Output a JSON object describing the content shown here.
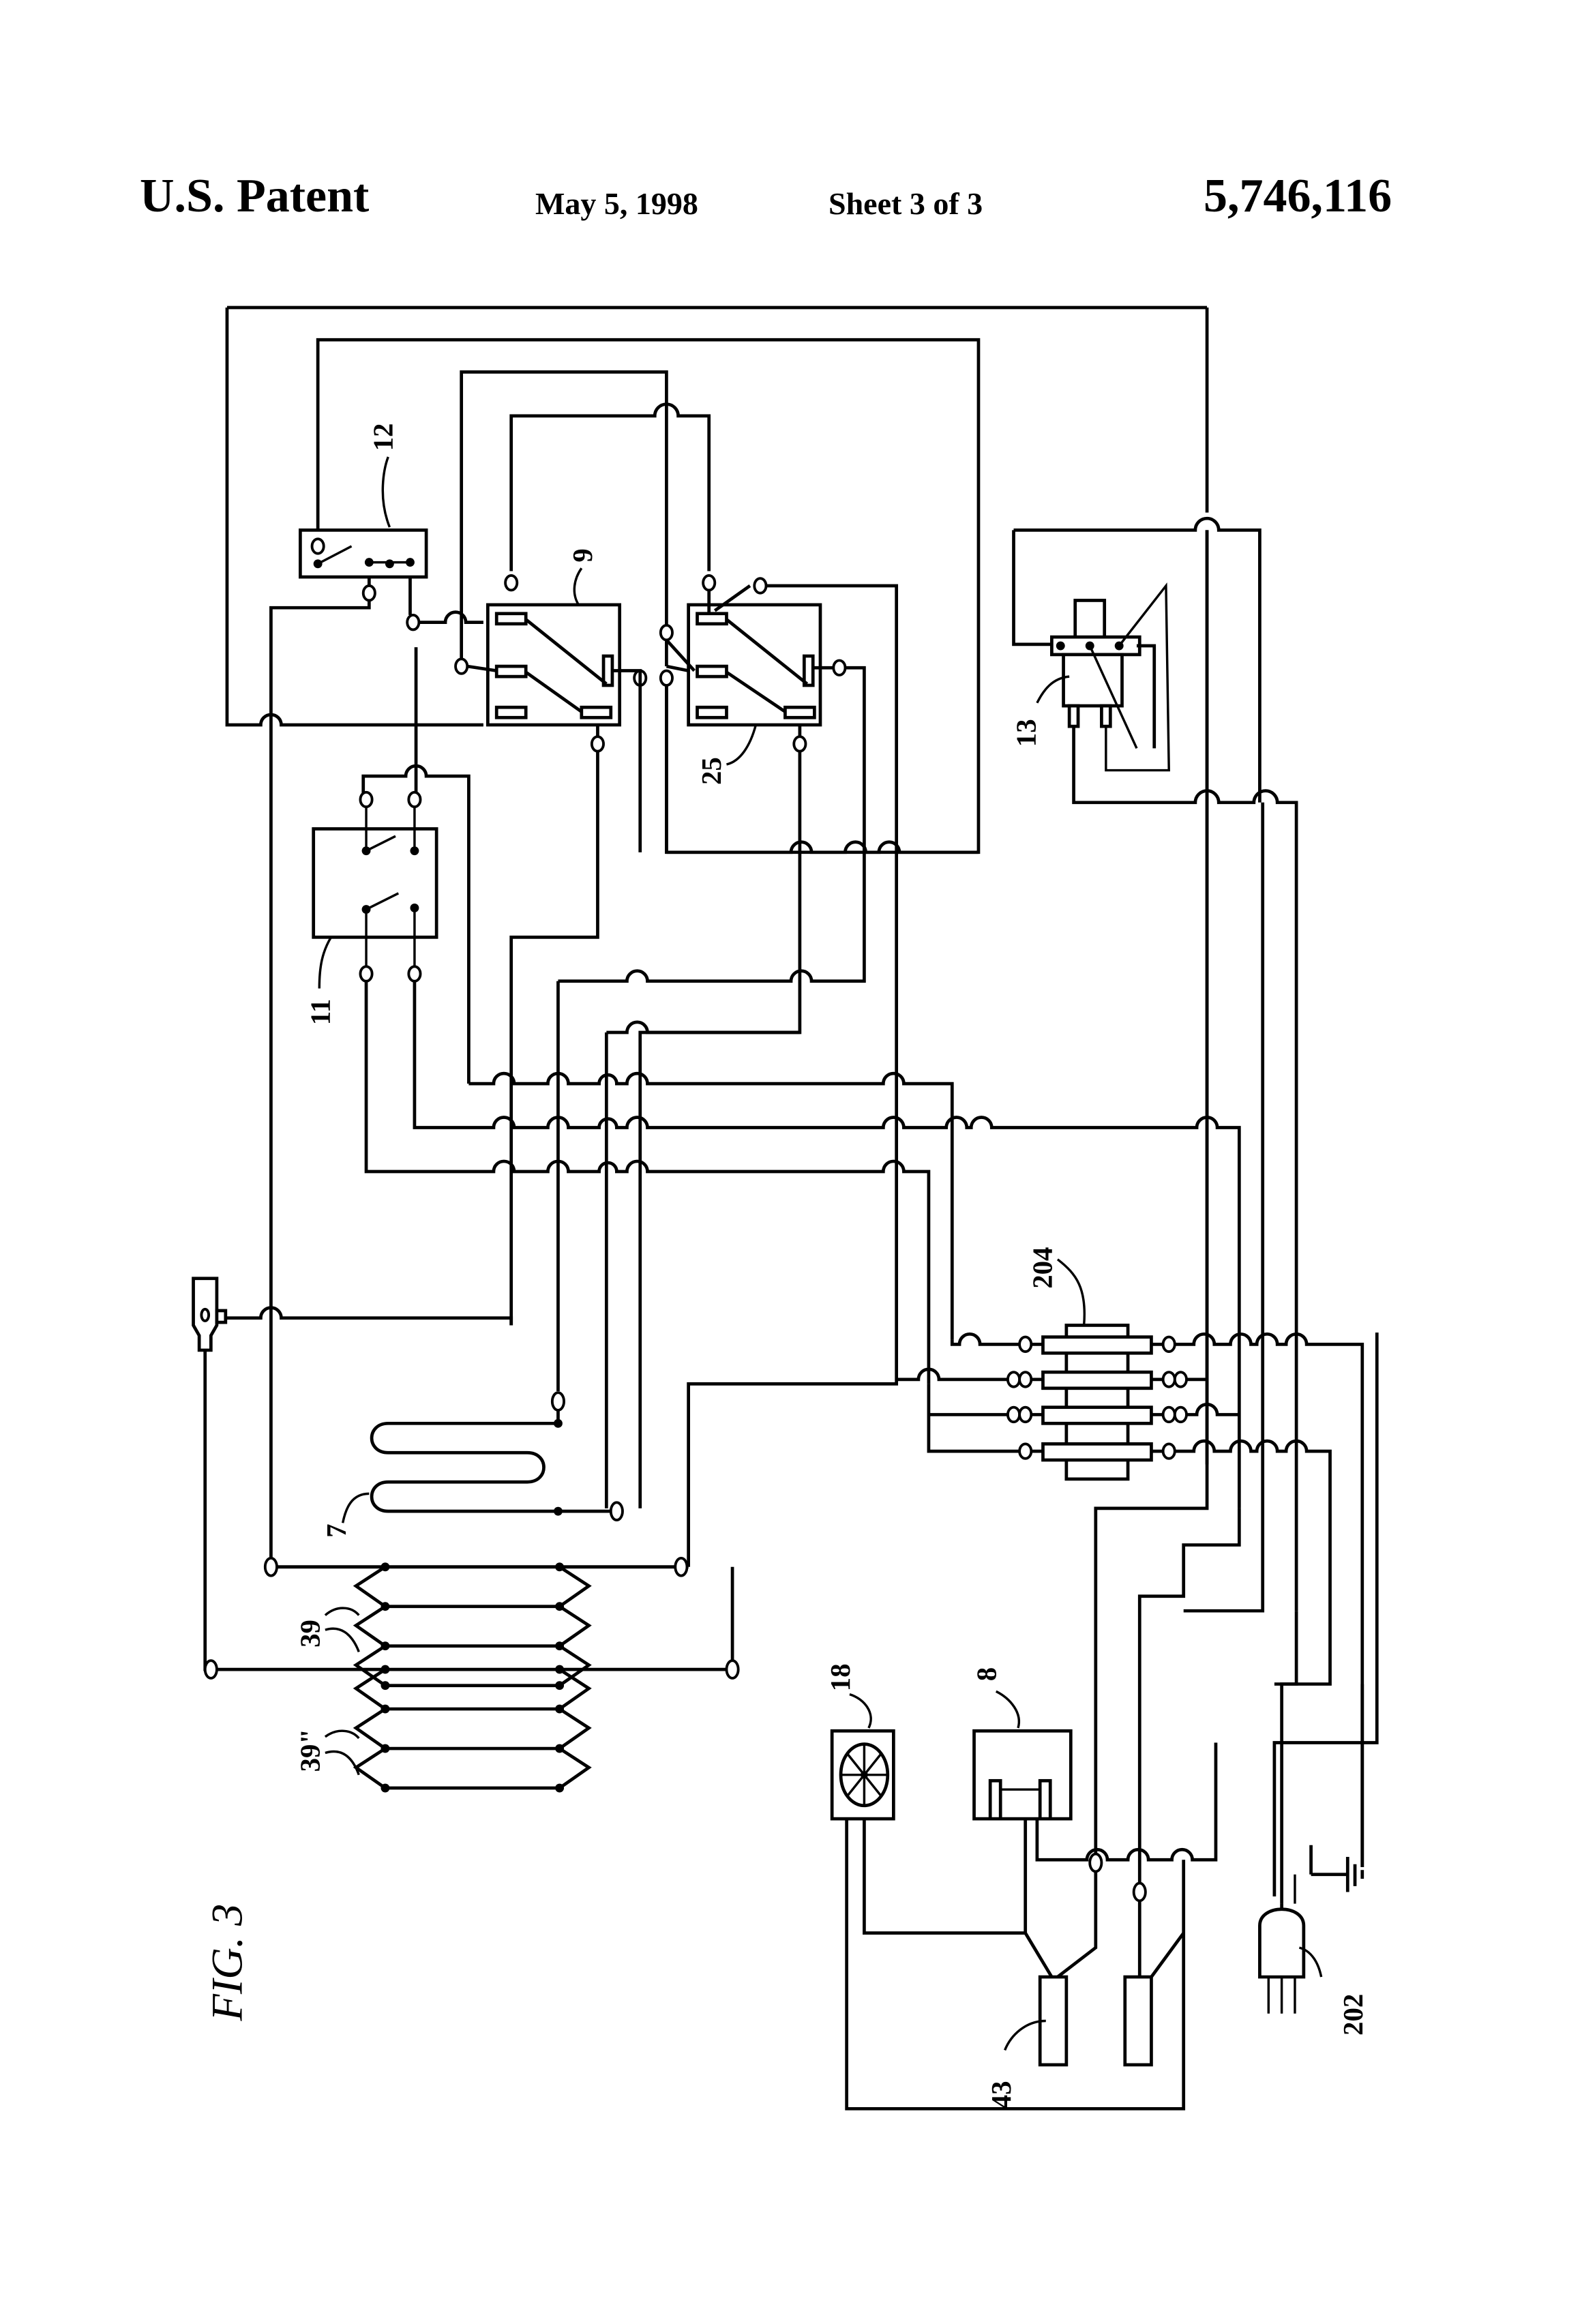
{
  "header": {
    "title": "U.S. Patent",
    "date": "May 5, 1998",
    "sheet": "Sheet 3 of 3",
    "patent_number": "5,746,116"
  },
  "figure": {
    "caption": "FIG. 3",
    "type": "electrical wiring schematic"
  },
  "components": {
    "thermostat_switch": "12",
    "relay_9": "9",
    "relay_25": "25",
    "valve_13": "13",
    "double_switch": "11",
    "heater": "7",
    "heater_coils_upper": "39",
    "heater_coils_lower": "39\"",
    "terminal_block": "204",
    "fan": "18",
    "compressor": "8",
    "sensor": "43",
    "power_plug": "202"
  }
}
